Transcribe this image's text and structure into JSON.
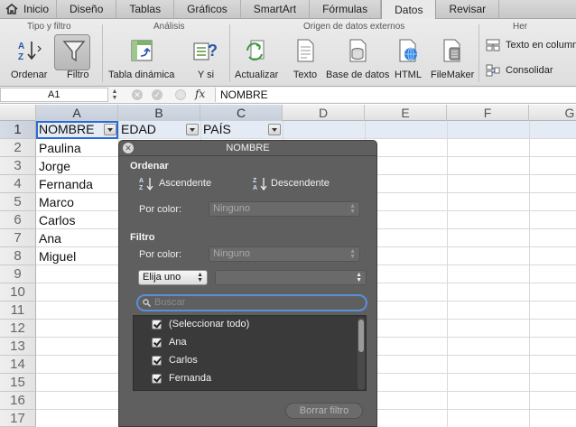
{
  "ribbon": {
    "tabs": [
      "Inicio",
      "Diseño",
      "Tablas",
      "Gráficos",
      "SmartArt",
      "Fórmulas",
      "Datos",
      "Revisar"
    ],
    "active_tab": "Datos",
    "groups": {
      "tipo_filtro": "Tipo y filtro",
      "analisis": "Análisis",
      "origen": "Origen de datos externos",
      "herramientas": "Her"
    },
    "buttons": {
      "ordenar": "Ordenar",
      "filtro": "Filtro",
      "tabla_dinamica": "Tabla dinámica",
      "y_si": "Y si",
      "actualizar": "Actualizar",
      "texto": "Texto",
      "base_datos": "Base de datos",
      "html": "HTML",
      "filemaker": "FileMaker",
      "texto_columnas": "Texto en column",
      "consolidar": "Consolidar"
    }
  },
  "formula_bar": {
    "cell_ref": "A1",
    "fx": "fx",
    "content": "NOMBRE"
  },
  "grid": {
    "columns": [
      "A",
      "B",
      "C",
      "D",
      "E",
      "F",
      "G"
    ],
    "rows": [
      "1",
      "2",
      "3",
      "4",
      "5",
      "6",
      "7",
      "8",
      "9",
      "10",
      "11",
      "12",
      "13",
      "14",
      "15",
      "16",
      "17"
    ],
    "headers": [
      "NOMBRE",
      "EDAD",
      "PAÍS"
    ],
    "names": [
      "Paulina",
      "Jorge",
      "Fernanda",
      "Marco",
      "Carlos",
      "Ana",
      "Miguel"
    ]
  },
  "filter_popup": {
    "title": "NOMBRE",
    "ordenar_label": "Ordenar",
    "ascendente": "Ascendente",
    "descendente": "Descendente",
    "por_color": "Por color:",
    "ninguno": "Ninguno",
    "filtro_label": "Filtro",
    "elija_uno": "Elija uno",
    "search_placeholder": "Buscar",
    "list_items": [
      "(Seleccionar todo)",
      "Ana",
      "Carlos",
      "Fernanda"
    ],
    "clear_button": "Borrar filtro"
  },
  "colors": {
    "selection_blue": "#2a6bd4",
    "header_row_fill": "#e4ebf5",
    "popup_bg": "#585858"
  }
}
